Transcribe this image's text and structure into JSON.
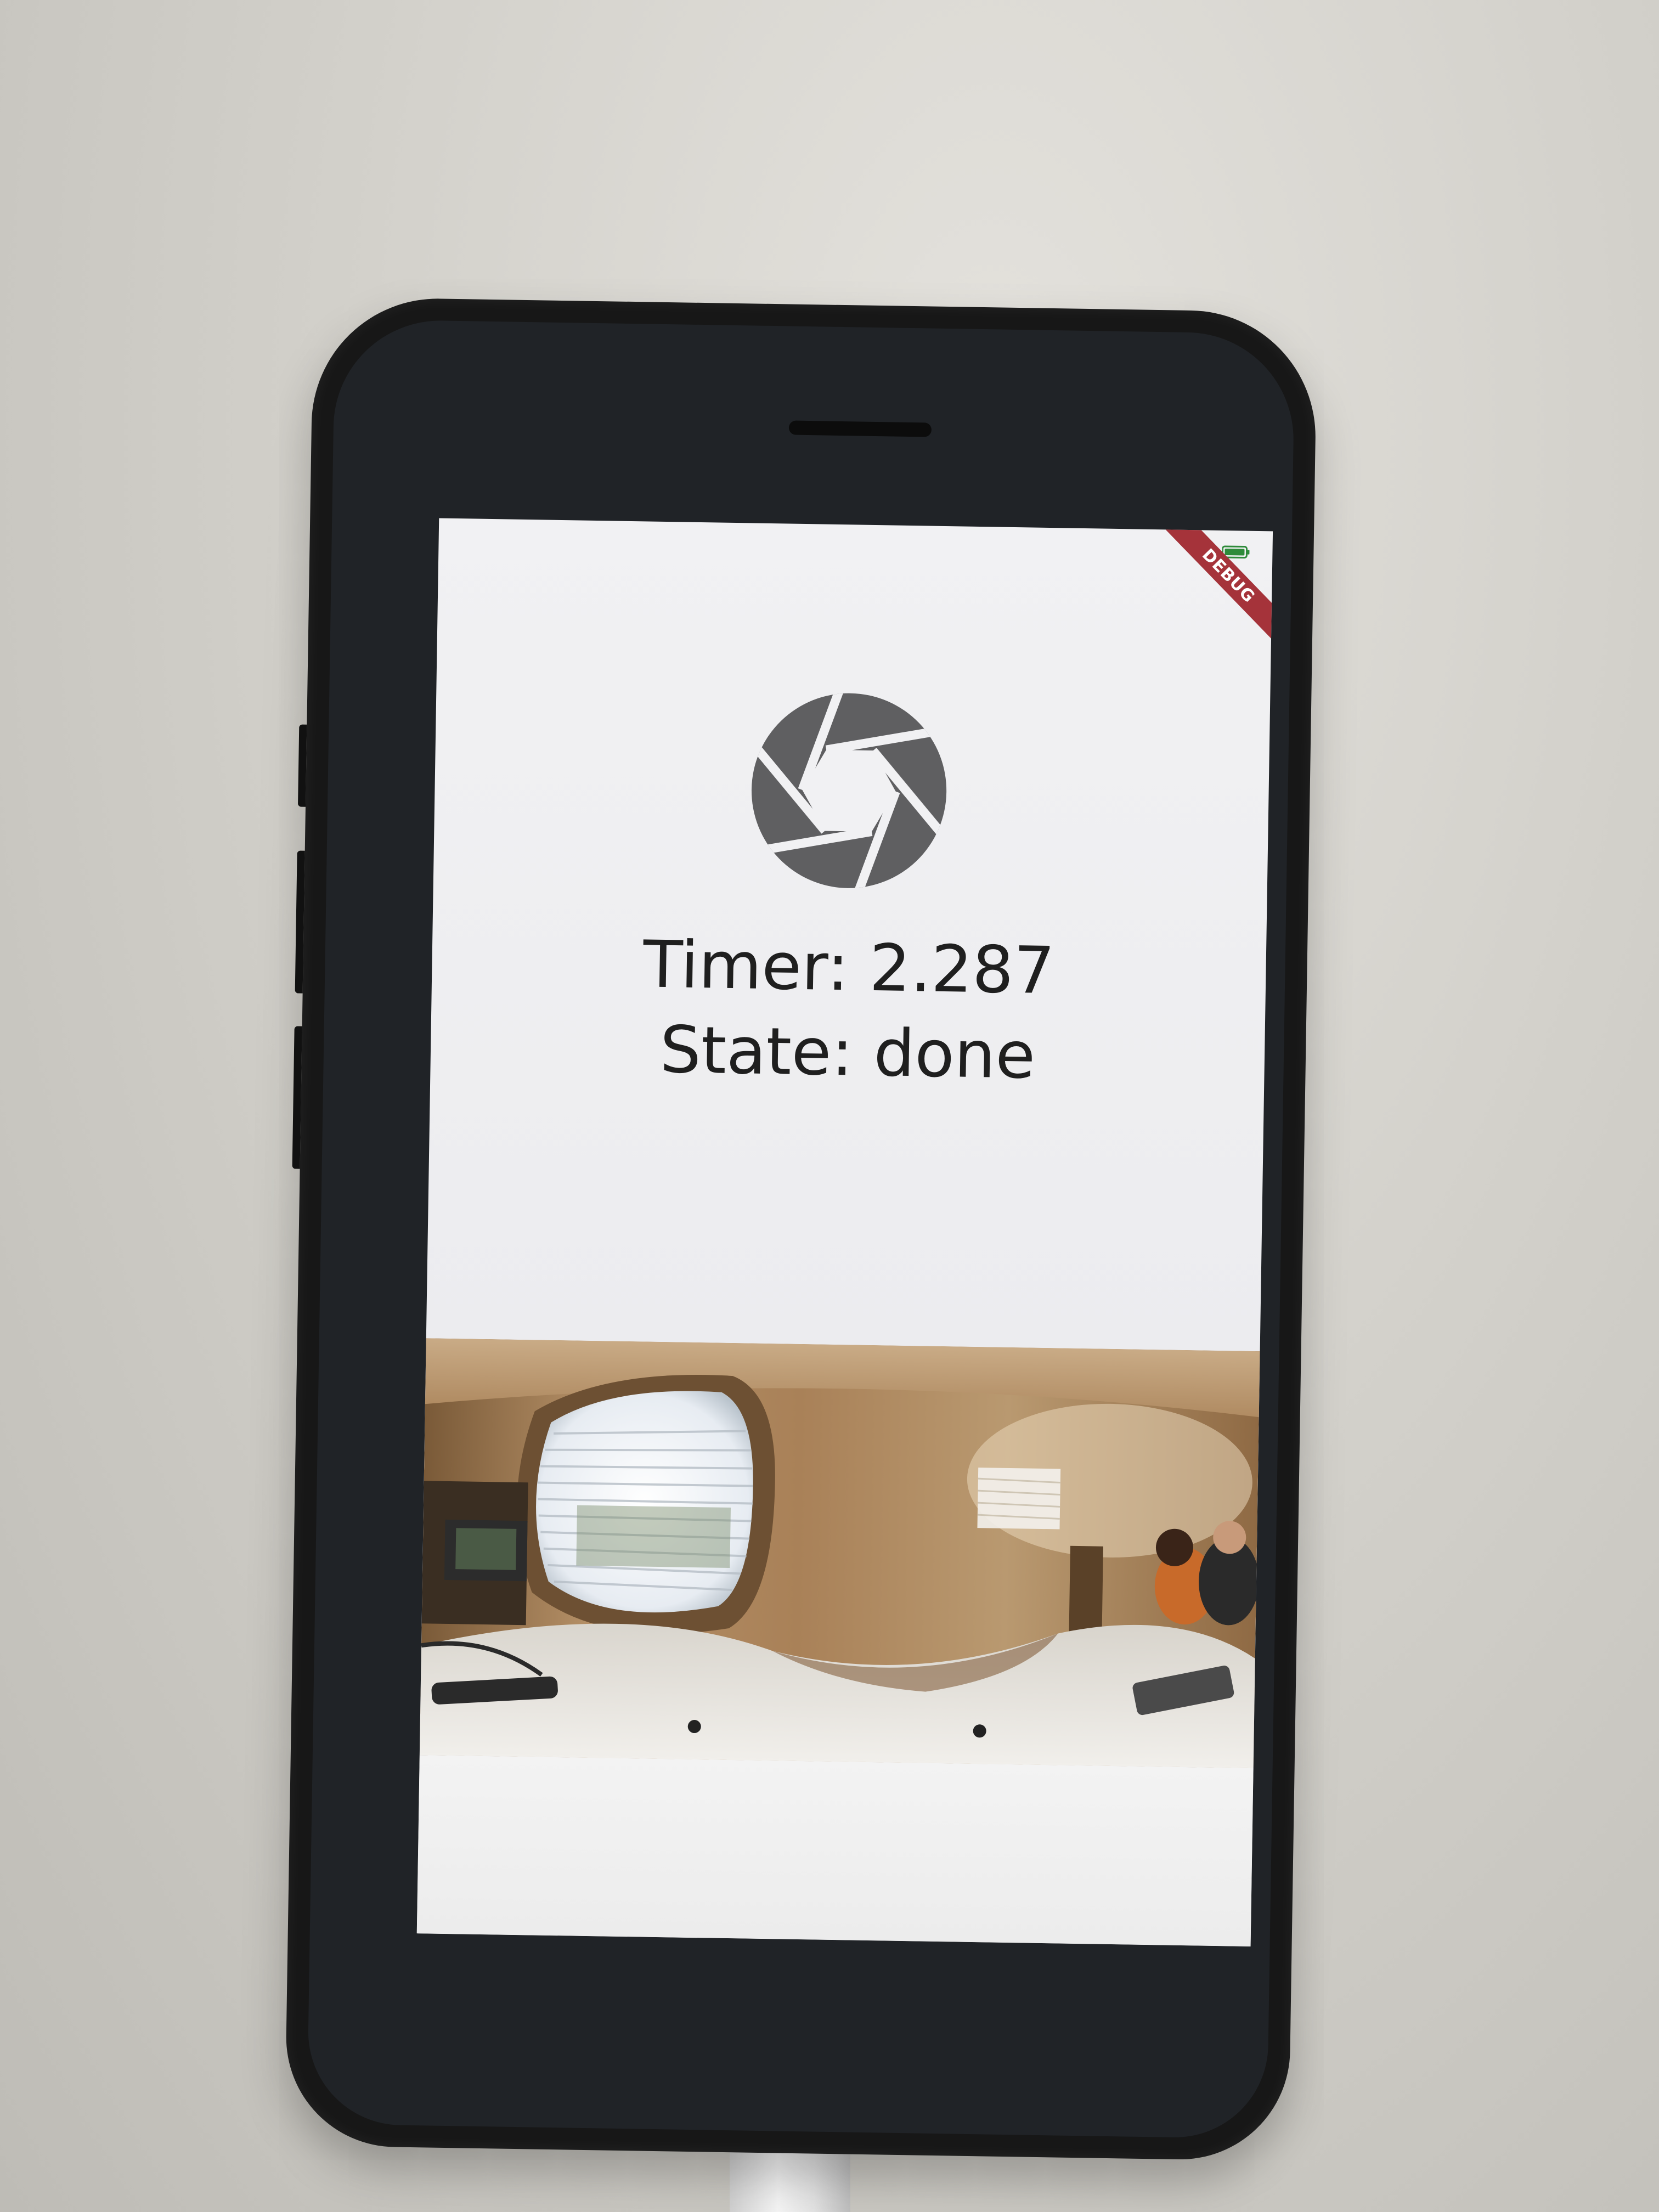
{
  "app": {
    "debug_banner": "DEBUG",
    "shutter_icon": "camera-shutter-icon",
    "battery_icon": "battery-charging-icon",
    "timer_text": "Timer: 2.287",
    "state_text": "State: done",
    "panorama_image": "equirectangular-360-office-photo"
  },
  "colors": {
    "screen_background": "#f1f1f3",
    "icon_gray": "#5f5f61",
    "text": "#1f1f1f",
    "debug_red": "#a5333a",
    "phone_case": "#171717"
  }
}
